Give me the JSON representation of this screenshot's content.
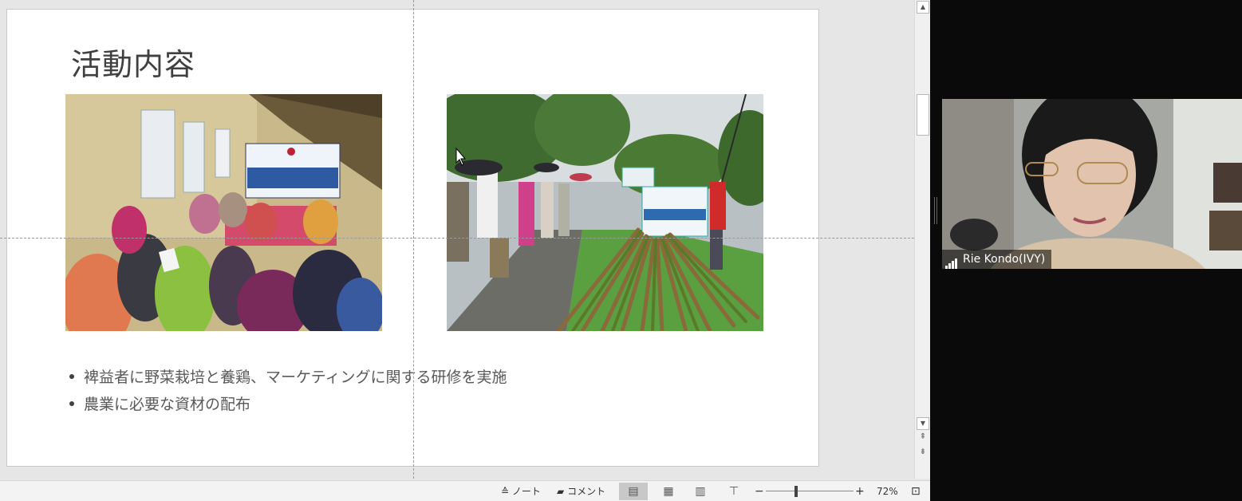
{
  "slide": {
    "title": "活動内容",
    "bullets": [
      "裨益者に野菜栽培と養鶏、マーケティングに関する研修を実施",
      "農業に必要な資材の配布"
    ]
  },
  "status_bar": {
    "notes_label": "ノート",
    "comments_label": "コメント",
    "zoom": "72%"
  },
  "video": {
    "participant_name": "Rie Kondo(IVY)"
  },
  "colors": {
    "editor_bg": "#e6e6e6",
    "slide_bg": "#ffffff",
    "title_text": "#404040",
    "body_text": "#595959"
  }
}
